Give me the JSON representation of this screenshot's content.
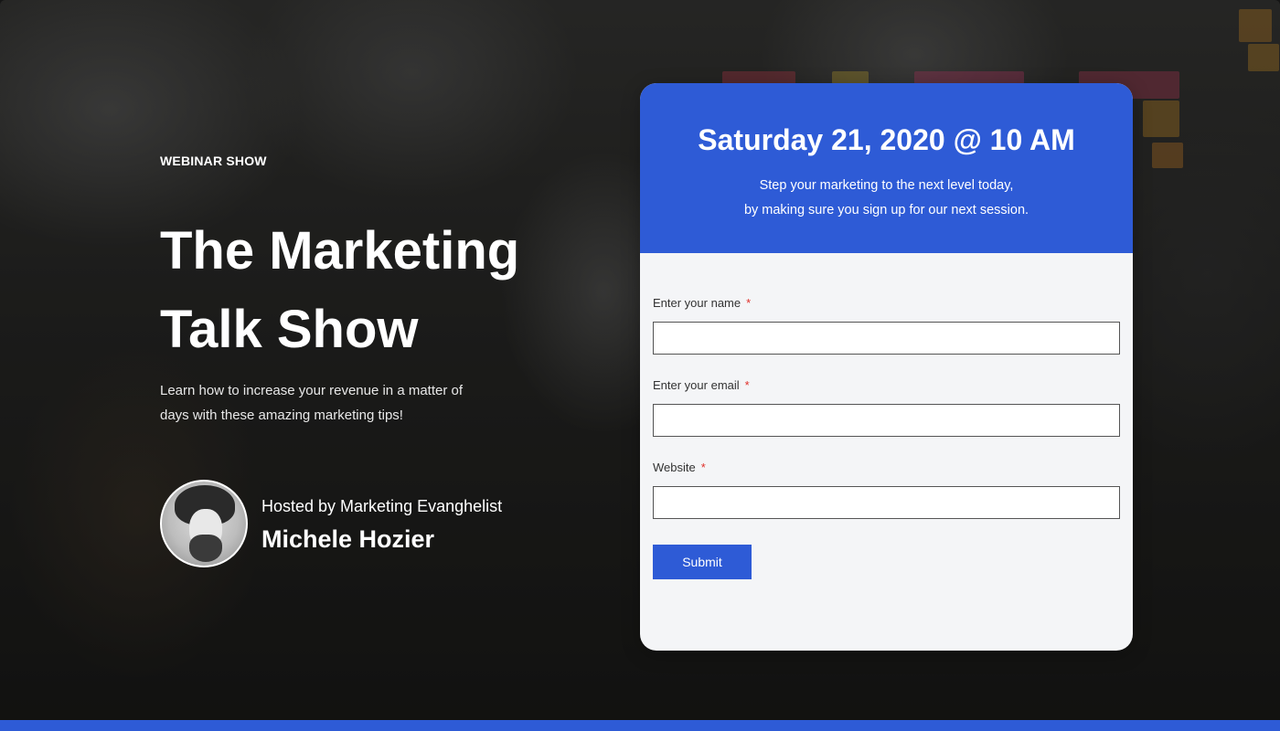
{
  "hero": {
    "eyebrow": "WEBINAR SHOW",
    "title_line1": "The Marketing",
    "title_line2": "Talk Show",
    "description": "Learn how to increase your revenue in a matter of days with these amazing marketing tips!",
    "host_subtitle": "Hosted by Marketing Evanghelist",
    "host_name": "Michele Hozier"
  },
  "card": {
    "date": "Saturday 21, 2020 @ 10 AM",
    "subtitle_line1": "Step your marketing to the next level today,",
    "subtitle_line2": "by making sure you sign up for our next session.",
    "fields": [
      {
        "label": "Enter your name",
        "required_mark": "*",
        "value": ""
      },
      {
        "label": "Enter your email",
        "required_mark": "*",
        "value": ""
      },
      {
        "label": "Website",
        "required_mark": "*",
        "value": ""
      }
    ],
    "submit_label": "Submit"
  },
  "colors": {
    "accent": "#2e5bd6",
    "required": "#e0302a",
    "form_bg": "#f4f5f7"
  }
}
